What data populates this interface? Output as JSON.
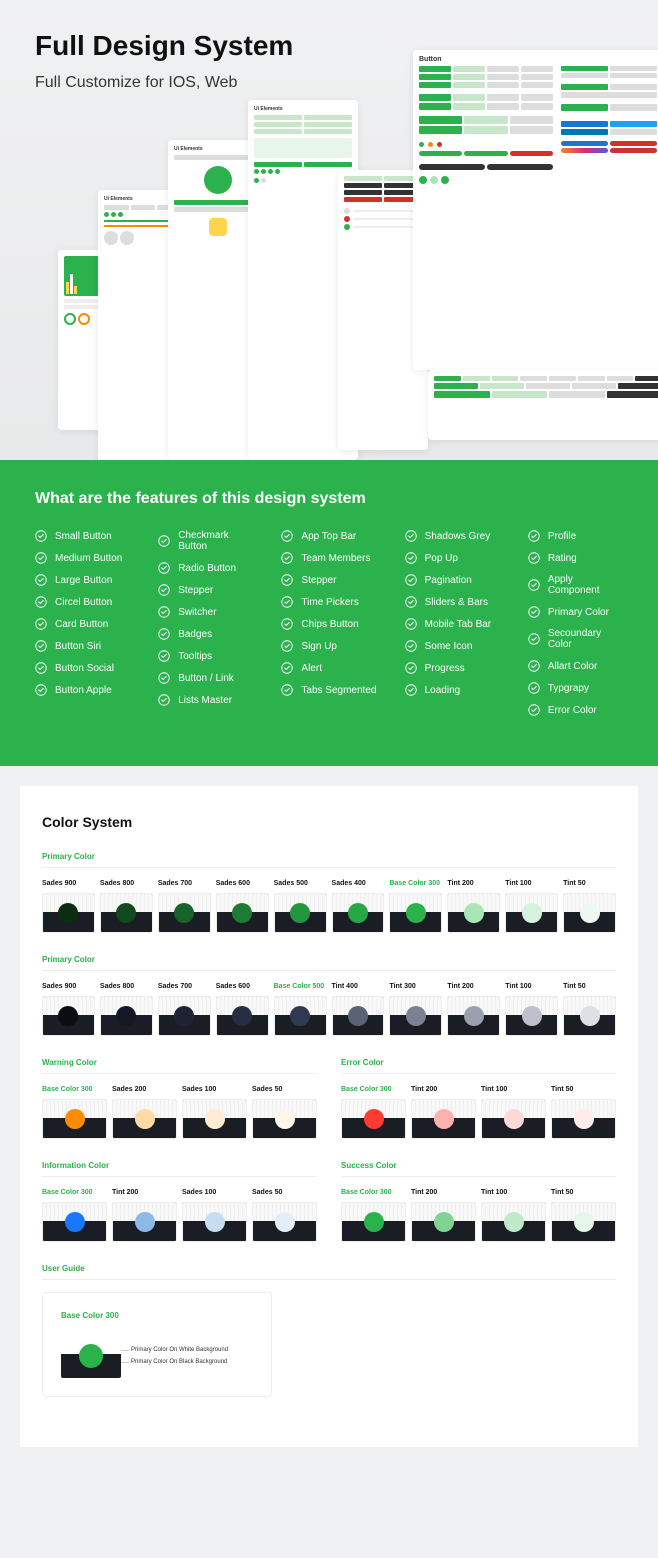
{
  "hero": {
    "title": "Full Design System",
    "subtitle": "Full Customize for IOS, Web",
    "mock_label_ui": "Ui Elements",
    "mock_label_button": "Button"
  },
  "features": {
    "title": "What are the features of this design system",
    "cols": [
      [
        "Small Button",
        "Medium Button",
        "Large Button",
        "Circel Button",
        "Card Button",
        "Button Siri",
        "Button Social",
        "Button Apple"
      ],
      [
        "Checkmark Button",
        "Radio Button",
        "Stepper",
        "Switcher",
        "Badges",
        "Tooltips",
        "Button / Link",
        "Lists Master"
      ],
      [
        "App Top Bar",
        "Team Members",
        "Stepper",
        "Time Pickers",
        "Chips Button",
        "Sign Up",
        "Alert",
        "Tabs Segmented"
      ],
      [
        "Shadows Grey",
        "Pop Up",
        "Pagination",
        "Sliders & Bars",
        "Mobile Tab Bar",
        "Some Icon",
        "Progress",
        "Loading"
      ],
      [
        "Profile",
        "Rating",
        "Apply Component",
        "Primary Color",
        "Secoundary Color",
        "Allart Color",
        "Typgrapy",
        "Error Color"
      ]
    ]
  },
  "colors": {
    "title": "Color System",
    "primary": {
      "label": "Primary Color",
      "swatches": [
        {
          "label": "Sades 900",
          "hex": "#0b2e13"
        },
        {
          "label": "Sades 800",
          "hex": "#114a1f"
        },
        {
          "label": "Sades 700",
          "hex": "#17632a"
        },
        {
          "label": "Sades 600",
          "hex": "#1d7c35"
        },
        {
          "label": "Sades 500",
          "hex": "#22953f"
        },
        {
          "label": "Sades 400",
          "hex": "#28a745"
        },
        {
          "label": "Base Color 300",
          "hex": "#2bb24c",
          "base": true
        },
        {
          "label": "Tint 200",
          "hex": "#a8e6b8"
        },
        {
          "label": "Tint 100",
          "hex": "#d4f2dc"
        },
        {
          "label": "Tint 50",
          "hex": "#edf9f0"
        }
      ]
    },
    "secondary": {
      "label": "Primary Color",
      "swatches": [
        {
          "label": "Sades 900",
          "hex": "#0a0d14"
        },
        {
          "label": "Sades 800",
          "hex": "#141824"
        },
        {
          "label": "Sades 700",
          "hex": "#1d2333"
        },
        {
          "label": "Sades 600",
          "hex": "#272e42"
        },
        {
          "label": "Base Color 500",
          "hex": "#303952",
          "base": true
        },
        {
          "label": "Tint 400",
          "hex": "#5a6275"
        },
        {
          "label": "Tint 300",
          "hex": "#7a8192"
        },
        {
          "label": "Tint 200",
          "hex": "#9ba0ae"
        },
        {
          "label": "Tint 100",
          "hex": "#bdc0ca"
        },
        {
          "label": "Tint 50",
          "hex": "#dee0e5"
        }
      ]
    },
    "warning": {
      "label": "Warning Color",
      "swatches": [
        {
          "label": "Base Color 300",
          "hex": "#ff8c00",
          "base": true
        },
        {
          "label": "Sades 200",
          "hex": "#ffd9a6"
        },
        {
          "label": "Sades 100",
          "hex": "#ffecd3"
        },
        {
          "label": "Sades 50",
          "hex": "#fff6e9"
        }
      ]
    },
    "error": {
      "label": "Error Color",
      "swatches": [
        {
          "label": "Base Color 300",
          "hex": "#ff3b30",
          "base": true
        },
        {
          "label": "Tint 200",
          "hex": "#ffb1ad"
        },
        {
          "label": "Tint 100",
          "hex": "#ffd8d6"
        },
        {
          "label": "Tint 50",
          "hex": "#ffecea"
        }
      ]
    },
    "information": {
      "label": "Information Color",
      "swatches": [
        {
          "label": "Base Color 300",
          "hex": "#1976ff",
          "base": true
        },
        {
          "label": "Tint 200",
          "hex": "#8cb9e8"
        },
        {
          "label": "Sades 100",
          "hex": "#c6dcf3"
        },
        {
          "label": "Sades 50",
          "hex": "#e3eef9"
        }
      ]
    },
    "success": {
      "label": "Success Color",
      "swatches": [
        {
          "label": "Base Color 300",
          "hex": "#2bb24c",
          "base": true
        },
        {
          "label": "Tint 200",
          "hex": "#7fd493"
        },
        {
          "label": "Tint 100",
          "hex": "#bfe9c9"
        },
        {
          "label": "Tint 50",
          "hex": "#e5f6ea"
        }
      ]
    },
    "guide": {
      "label": "User Guide",
      "card_title": "Base Color 300",
      "line1": "Primary Color On White Background",
      "line2": "Primary Color On Black Background"
    }
  }
}
